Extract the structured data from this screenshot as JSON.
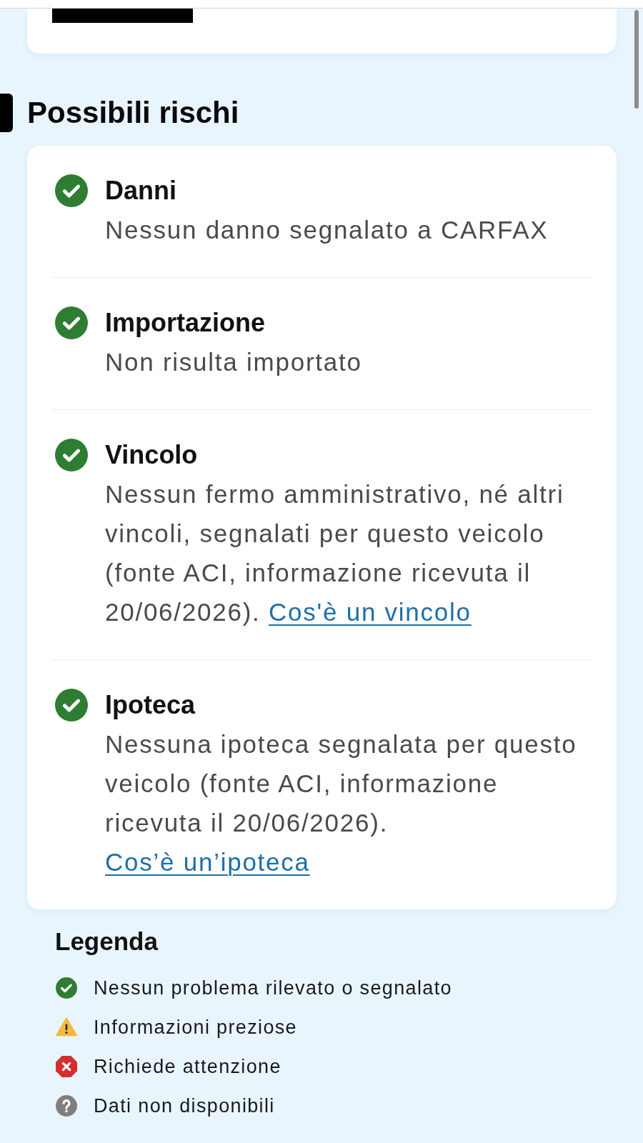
{
  "section": {
    "title": "Possibili rischi"
  },
  "risks": [
    {
      "kind": "ok",
      "title": "Danni",
      "description": "Nessun danno segnalato a CARFAX"
    },
    {
      "kind": "ok",
      "title": "Importazione",
      "description": "Non risulta importato"
    },
    {
      "kind": "ok",
      "title": "Vincolo",
      "description": "Nessun fermo amministrativo, né altri vincoli, segnalati per questo veicolo (fonte ACI, informazione ricevuta il 20/06/2026).",
      "link": "Cos'è un vincolo"
    },
    {
      "kind": "ok",
      "title": "Ipoteca",
      "description": "Nessuna ipoteca segnalata per questo veicolo (fonte ACI, informazione ricevuta il 20/06/2026).",
      "link": "Cos’è un’ipoteca"
    }
  ],
  "legend": {
    "title": "Legenda",
    "items": [
      {
        "kind": "ok",
        "label": "Nessun problema rilevato o segnalato"
      },
      {
        "kind": "warning",
        "label": "Informazioni preziose"
      },
      {
        "kind": "error",
        "label": "Richiede attenzione"
      },
      {
        "kind": "unknown",
        "label": "Dati non disponibili"
      }
    ]
  }
}
